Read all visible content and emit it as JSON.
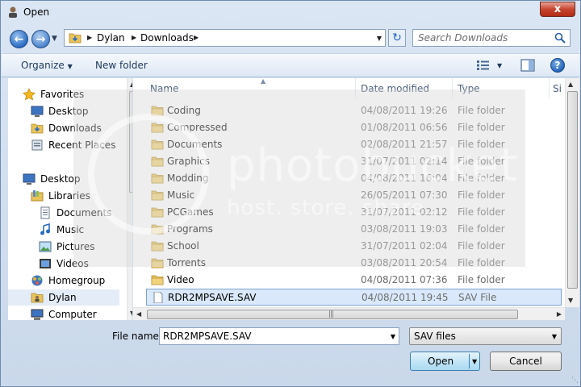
{
  "window": {
    "title": "Open",
    "close_label": "x"
  },
  "address": {
    "segments": [
      "Dylan",
      "Downloads"
    ],
    "search_placeholder": "Search Downloads"
  },
  "toolbar": {
    "organize_label": "Organize",
    "new_folder_label": "New folder",
    "help_label": "?"
  },
  "nav_pane": {
    "items": [
      {
        "label": "Favorites",
        "icon": "star-icon"
      },
      {
        "label": "Desktop",
        "icon": "desktop-icon"
      },
      {
        "label": "Downloads",
        "icon": "downloads-icon"
      },
      {
        "label": "Recent Places",
        "icon": "recent-places-icon"
      },
      {
        "label": "Desktop",
        "icon": "desktop-icon"
      },
      {
        "label": "Libraries",
        "icon": "libraries-icon"
      },
      {
        "label": "Documents",
        "icon": "documents-icon"
      },
      {
        "label": "Music",
        "icon": "music-icon"
      },
      {
        "label": "Pictures",
        "icon": "pictures-icon"
      },
      {
        "label": "Videos",
        "icon": "videos-icon"
      },
      {
        "label": "Homegroup",
        "icon": "homegroup-icon"
      },
      {
        "label": "Dylan",
        "icon": "user-folder-icon"
      },
      {
        "label": "Computer",
        "icon": "computer-icon"
      }
    ]
  },
  "file_list": {
    "columns": [
      "Name",
      "Date modified",
      "Type",
      "Si"
    ],
    "rows": [
      {
        "name": "Coding",
        "date": "04/08/2011 19:26",
        "type": "File folder"
      },
      {
        "name": "Compressed",
        "date": "01/08/2011 06:56",
        "type": "File folder"
      },
      {
        "name": "Documents",
        "date": "02/08/2011 21:57",
        "type": "File folder"
      },
      {
        "name": "Graphics",
        "date": "31/07/2011 02:14",
        "type": "File folder"
      },
      {
        "name": "Modding",
        "date": "04/08/2011 16:04",
        "type": "File folder"
      },
      {
        "name": "Music",
        "date": "26/05/2011 07:30",
        "type": "File folder"
      },
      {
        "name": "PCGames",
        "date": "31/07/2011 02:12",
        "type": "File folder"
      },
      {
        "name": "Programs",
        "date": "03/08/2011 19:03",
        "type": "File folder"
      },
      {
        "name": "School",
        "date": "31/07/2011 02:04",
        "type": "File folder"
      },
      {
        "name": "Torrents",
        "date": "03/08/2011 20:54",
        "type": "File folder"
      },
      {
        "name": "Video",
        "date": "04/08/2011 07:36",
        "type": "File folder"
      },
      {
        "name": "RDR2MPSAVE.SAV",
        "date": "04/08/2011 19:45",
        "type": "SAV File"
      }
    ],
    "selected_index": 11
  },
  "watermark": {
    "line1": "photobucket",
    "line2": "host. store. share."
  },
  "bottom": {
    "file_name_label": "File name:",
    "file_name_value": "RDR2MPSAVE.SAV",
    "filter_value": "SAV files",
    "open_label": "Open",
    "cancel_label": "Cancel"
  },
  "colors": {
    "accent": "#2a6cc4",
    "folder": "#e8c35a",
    "selection": "#d9e9fb"
  }
}
